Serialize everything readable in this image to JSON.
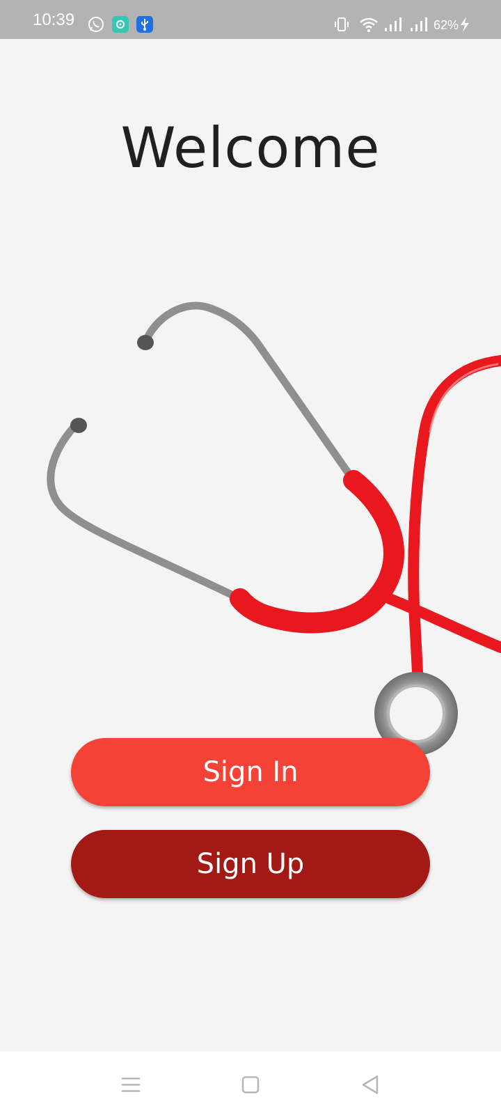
{
  "status_bar": {
    "time": "10:39",
    "battery": "62%",
    "icons": [
      "whatsapp-icon",
      "app-icon",
      "usb-icon",
      "vibrate-icon",
      "wifi-icon",
      "signal-icon",
      "signal-icon",
      "charging-icon"
    ]
  },
  "main": {
    "title": "Welcome",
    "illustration": "stethoscope-illustration"
  },
  "buttons": {
    "sign_in": "Sign In",
    "sign_up": "Sign Up"
  },
  "nav_bar": {
    "icons": [
      "menu-icon",
      "home-icon",
      "back-icon"
    ]
  },
  "colors": {
    "status_bar": "#b3b3b3",
    "background": "#f4f4f4",
    "sign_in": "#f44336",
    "sign_up": "#a31a15",
    "stethoscope_tube": "#e8181e",
    "stethoscope_metal": "#8c8c8c"
  }
}
